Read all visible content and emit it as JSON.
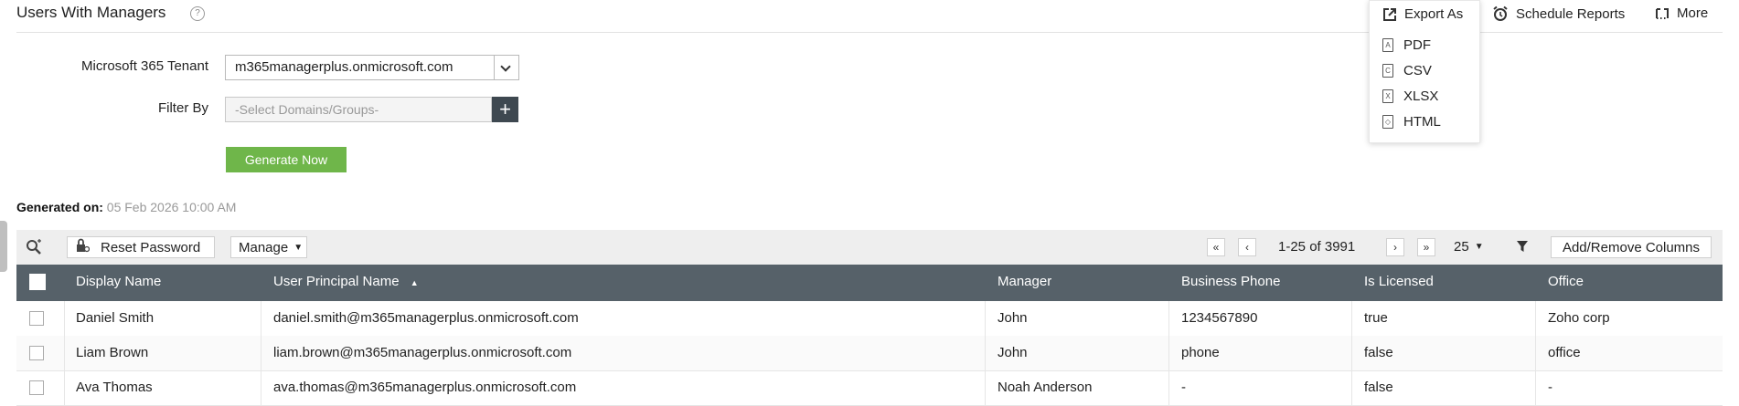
{
  "header": {
    "title": "Users With Managers",
    "help_glyph": "?",
    "schedule_label": "Schedule Reports",
    "more_label": "More"
  },
  "export_menu": {
    "title": "Export As",
    "items": [
      {
        "label": "PDF",
        "glyph": "A"
      },
      {
        "label": "CSV",
        "glyph": "C"
      },
      {
        "label": "XLSX",
        "glyph": "X"
      },
      {
        "label": "HTML",
        "glyph": "◇"
      }
    ]
  },
  "form": {
    "tenant_label": "Microsoft 365 Tenant",
    "tenant_value": "m365managerplus.onmicrosoft.com",
    "filter_label": "Filter By",
    "filter_placeholder": "-Select Domains/Groups-",
    "plus_glyph": "+",
    "generate_label": "Generate Now"
  },
  "generated": {
    "label": "Generated on:",
    "date": "05 Feb 2026 10:00 AM"
  },
  "toolbar": {
    "reset_password_label": "Reset Password",
    "manage_label": "Manage",
    "range_text": "1-25 of 3991",
    "page_size": "25",
    "add_remove_label": "Add/Remove Columns",
    "first_glyph": "«",
    "prev_glyph": "‹",
    "next_glyph": "›",
    "last_glyph": "»"
  },
  "table": {
    "columns": [
      "Display Name",
      "User Principal Name",
      "Manager",
      "Business Phone",
      "Is Licensed",
      "Office"
    ],
    "sort_indicator": "▲",
    "rows": [
      [
        "Daniel Smith",
        "daniel.smith@m365managerplus.onmicrosoft.com",
        "John",
        "1234567890",
        "true",
        "Zoho corp"
      ],
      [
        "Liam Brown",
        "liam.brown@m365managerplus.onmicrosoft.com",
        "John",
        "phone",
        "false",
        "office"
      ],
      [
        "Ava Thomas",
        "ava.thomas@m365managerplus.onmicrosoft.com",
        "Noah Anderson",
        "-",
        "false",
        "-"
      ]
    ]
  },
  "colors": {
    "accent_green": "#6fb64a",
    "table_header": "#566169",
    "toolbar_bg": "#eeeeee"
  }
}
